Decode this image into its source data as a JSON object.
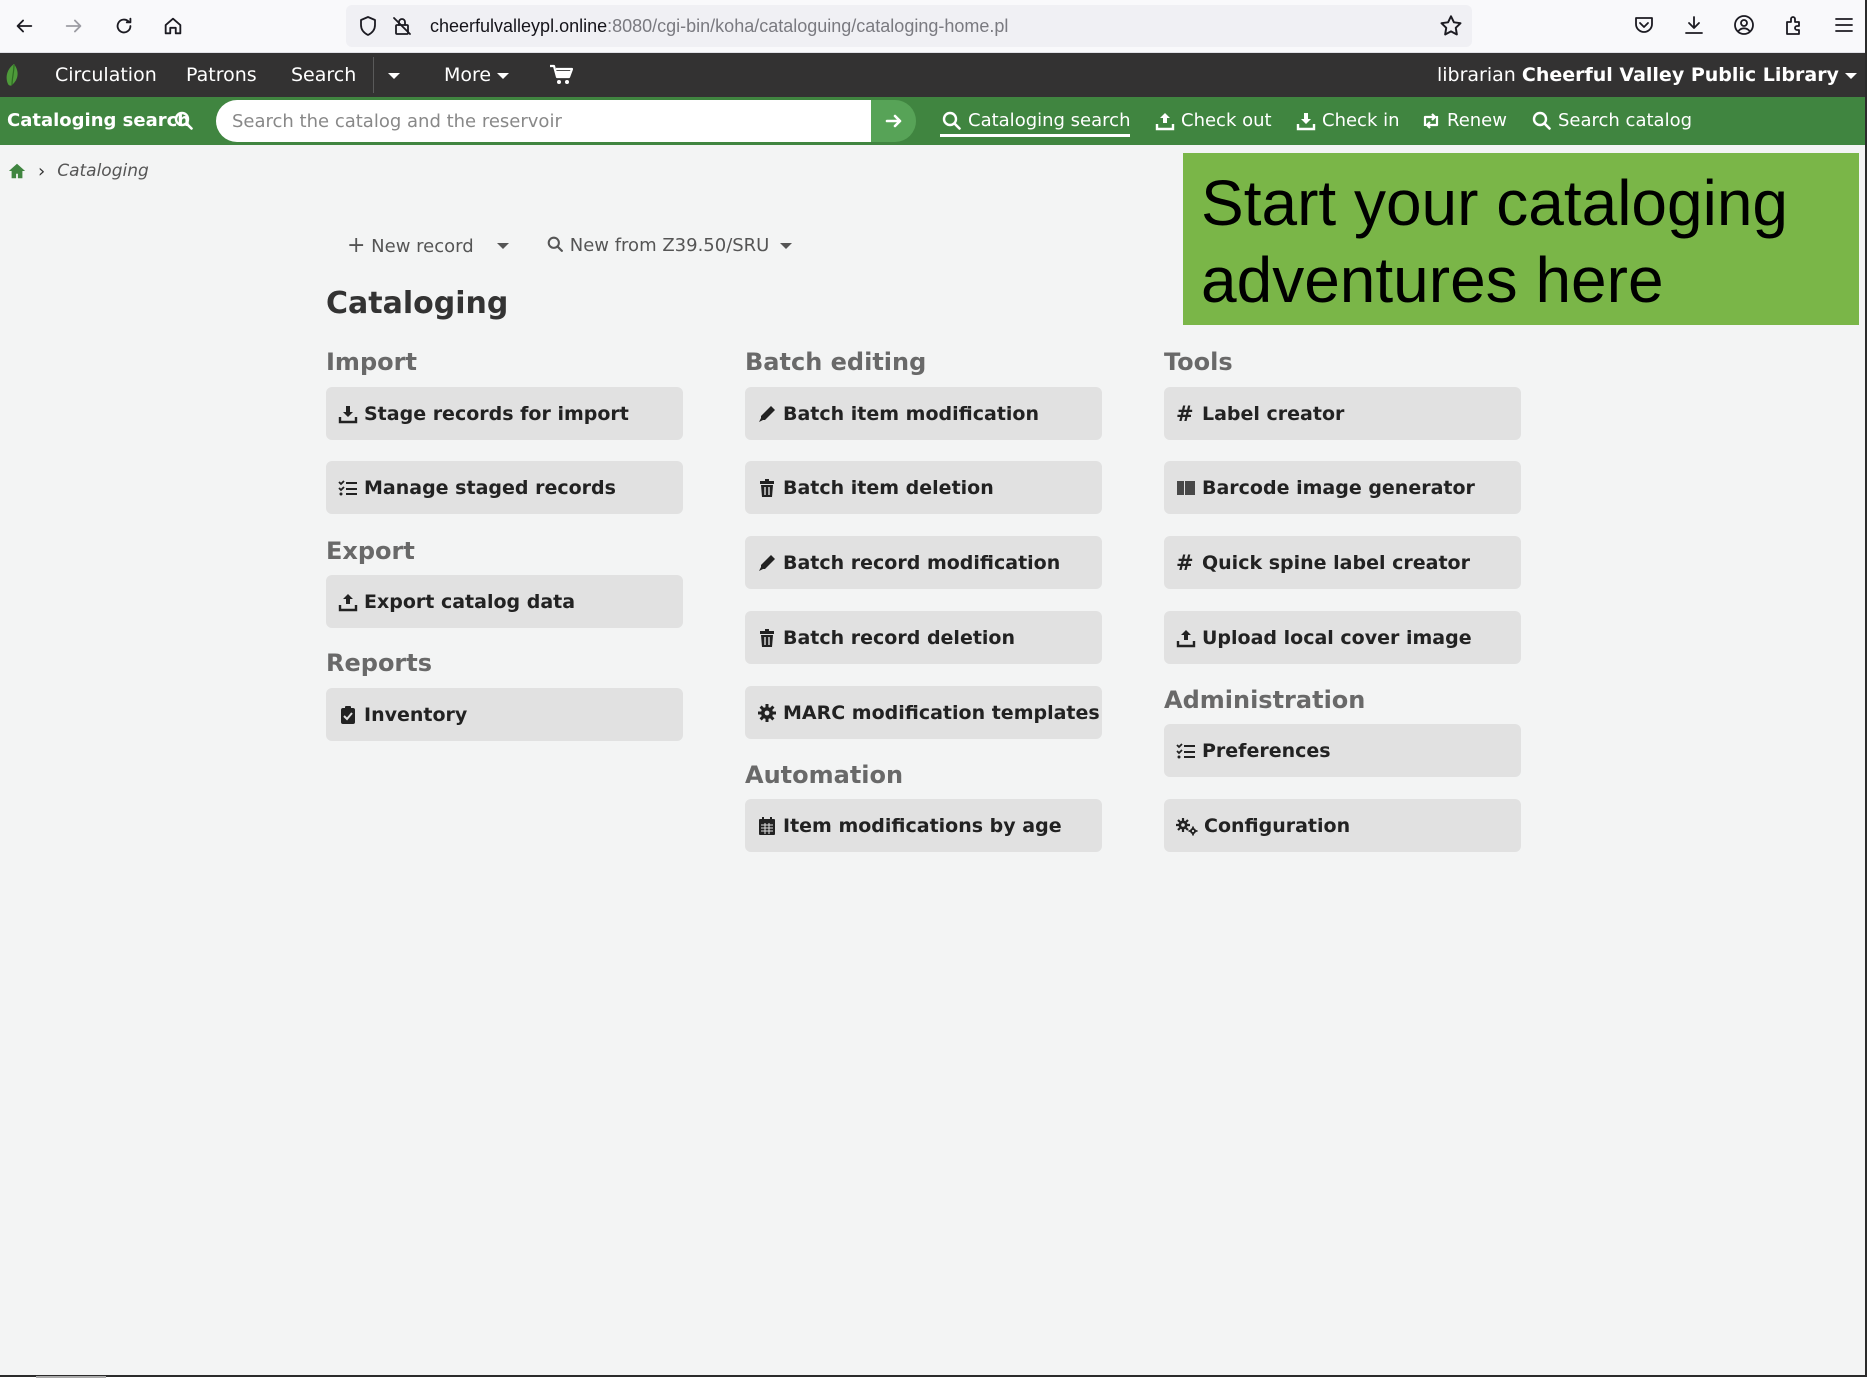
{
  "browser": {
    "url_host": "cheerfulvalleypl.online",
    "url_rest": ":8080/cgi-bin/koha/cataloguing/cataloging-home.pl",
    "icons": [
      "back-icon",
      "forward-icon",
      "reload-icon",
      "home-icon",
      "shield-icon",
      "insecure-lock-icon",
      "star-icon",
      "pocket-icon",
      "download-icon",
      "account-icon",
      "extensions-icon",
      "menu-icon"
    ]
  },
  "top_nav": {
    "items": [
      {
        "label": "Circulation"
      },
      {
        "label": "Patrons"
      },
      {
        "label": "Search"
      },
      {
        "label": "More"
      }
    ],
    "user_prefix": "librarian",
    "library": "Cheerful Valley Public Library"
  },
  "search_bar": {
    "label": "Cataloging search",
    "placeholder": "Search the catalog and the reservoir",
    "quick_links": [
      {
        "label": "Cataloging search",
        "icon": "search-icon",
        "active": true
      },
      {
        "label": "Check out",
        "icon": "upload-icon"
      },
      {
        "label": "Check in",
        "icon": "download-icon"
      },
      {
        "label": "Renew",
        "icon": "retweet-icon"
      },
      {
        "label": "Search catalog",
        "icon": "search-icon"
      }
    ]
  },
  "breadcrumb": {
    "current": "Cataloging"
  },
  "toolbar": {
    "new_record": "New record",
    "new_z3950": "New from Z39.50/SRU"
  },
  "page": {
    "title": "Cataloging"
  },
  "sections": {
    "import": {
      "title": "Import",
      "buttons": [
        "Stage records for import",
        "Manage staged records"
      ]
    },
    "export": {
      "title": "Export",
      "buttons": [
        "Export catalog data"
      ]
    },
    "reports": {
      "title": "Reports",
      "buttons": [
        "Inventory"
      ]
    },
    "batch_editing": {
      "title": "Batch editing",
      "buttons": [
        "Batch item modification",
        "Batch item deletion",
        "Batch record modification",
        "Batch record deletion",
        "MARC modification templates"
      ]
    },
    "automation": {
      "title": "Automation",
      "buttons": [
        "Item modifications by age"
      ]
    },
    "tools": {
      "title": "Tools",
      "buttons": [
        "Label creator",
        "Barcode image generator",
        "Quick spine label creator",
        "Upload local cover image"
      ]
    },
    "administration": {
      "title": "Administration",
      "buttons": [
        "Preferences",
        "Configuration"
      ]
    }
  },
  "callout": {
    "text": "Start your cataloging adventures here",
    "color": "#7ab648"
  },
  "colors": {
    "top_nav_bg": "#333232",
    "search_bar_bg": "#408540",
    "button_bg": "#e1e1e1"
  }
}
